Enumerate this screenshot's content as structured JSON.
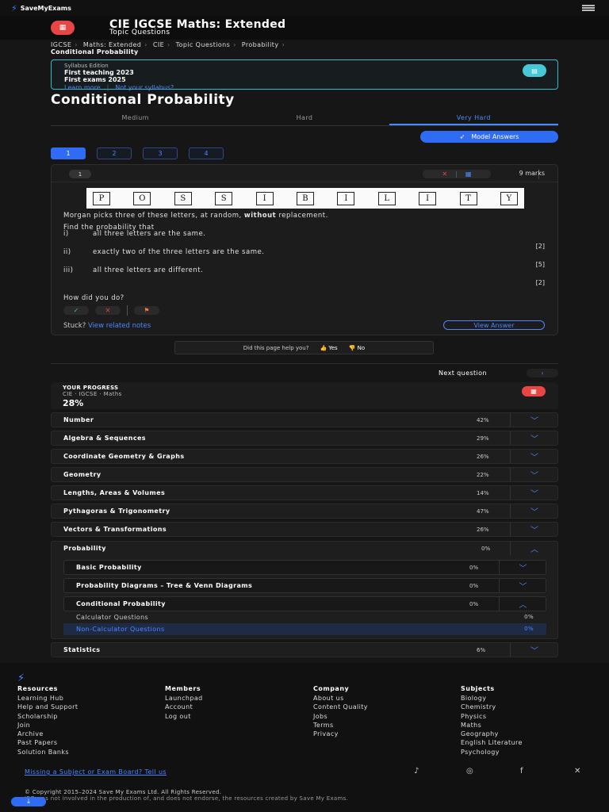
{
  "header": {
    "logo_text": "SaveMyExams",
    "course_icon": "calculator-icon",
    "course_title": "CIE IGCSE Maths: Extended",
    "course_subtitle": "Topic Questions"
  },
  "breadcrumb": {
    "items": [
      "IGCSE",
      "Maths: Extended",
      "CIE",
      "Topic Questions",
      "Probability"
    ],
    "current": "Conditional Probability"
  },
  "syllabus": {
    "label": "Syllabus Edition",
    "line1": "First teaching 2023",
    "line2": "First exams 2025",
    "learn_more": "Learn more",
    "not_your": "Not your syllabus?"
  },
  "page_title": "Conditional Probability",
  "difficulty_tabs": [
    "Medium",
    "Hard",
    "Very Hard"
  ],
  "active_difficulty": "Very Hard",
  "model_answers_label": "Model Answers",
  "question_numbers": [
    "1",
    "2",
    "3",
    "4"
  ],
  "question": {
    "number": "1",
    "marks": "9 marks",
    "letters": [
      "P",
      "O",
      "S",
      "S",
      "I",
      "B",
      "I",
      "L",
      "I",
      "T",
      "Y"
    ],
    "intro_pre": "Morgan picks three of these letters, at random,",
    "intro_bold": "without",
    "intro_post": "replacement.",
    "find": "Find the probability that",
    "parts": [
      {
        "label": "i)",
        "text": "all three letters are the same.",
        "marks": "[2]"
      },
      {
        "label": "ii)",
        "text": "exactly two of the three letters are the same.",
        "marks": "[5]"
      },
      {
        "label": "iii)",
        "text": "all three letters are different.",
        "marks": "[2]"
      }
    ],
    "how_did_you_do": "How did you do?",
    "stuck": "Stuck?",
    "view_notes": "View related notes",
    "view_answer": "View Answer"
  },
  "help_bar": {
    "question": "Did this page help you?",
    "yes": "Yes",
    "no": "No"
  },
  "next_question": "Next question",
  "progress": {
    "label": "YOUR PROGRESS",
    "sub": "CIE · IGCSE · Maths",
    "percent": "28%"
  },
  "topics": [
    {
      "name": "Number",
      "pct": "42%"
    },
    {
      "name": "Algebra & Sequences",
      "pct": "29%"
    },
    {
      "name": "Coordinate Geometry & Graphs",
      "pct": "26%"
    },
    {
      "name": "Geometry",
      "pct": "22%"
    },
    {
      "name": "Lengths, Areas & Volumes",
      "pct": "14%"
    },
    {
      "name": "Pythagoras & Trigonometry",
      "pct": "47%"
    },
    {
      "name": "Vectors & Transformations",
      "pct": "26%"
    }
  ],
  "probability": {
    "name": "Probability",
    "pct": "0%",
    "subtopics": [
      {
        "name": "Basic Probability",
        "pct": "0%"
      },
      {
        "name": "Probability Diagrams – Tree & Venn Diagrams",
        "pct": "0%"
      },
      {
        "name": "Conditional Probability",
        "pct": "0%"
      }
    ],
    "leaves": [
      {
        "name": "Calculator Questions",
        "pct": "0%"
      },
      {
        "name": "Non-Calculator Questions",
        "pct": "0%"
      }
    ]
  },
  "statistics": {
    "name": "Statistics",
    "pct": "6%"
  },
  "footer": {
    "resources": {
      "heading": "Resources",
      "items": [
        "Learning Hub",
        "Help and Support",
        "Scholarship",
        "Join",
        "Archive",
        "Past Papers",
        "Solution Banks"
      ]
    },
    "members": {
      "heading": "Members",
      "items": [
        "Launchpad",
        "Account",
        "Log out"
      ]
    },
    "company": {
      "heading": "Company",
      "items": [
        "About us",
        "Content Quality",
        "Jobs",
        "Terms",
        "Privacy"
      ]
    },
    "subjects": {
      "heading": "Subjects",
      "items": [
        "Biology",
        "Chemistry",
        "Physics",
        "Maths",
        "Geography",
        "English Literature",
        "Psychology"
      ]
    },
    "missing": "Missing a Subject or Exam Board? Tell us",
    "copyright": "© Copyright 2015–2024 Save My Exams Ltd. All Rights Reserved.",
    "disclaimer": "IBO was not involved in the production of, and does not endorse, the resources created by Save My Exams."
  },
  "colors": {
    "accent": "#2f6cf5",
    "brand_red": "#e84545",
    "teal": "#38b9c9"
  }
}
